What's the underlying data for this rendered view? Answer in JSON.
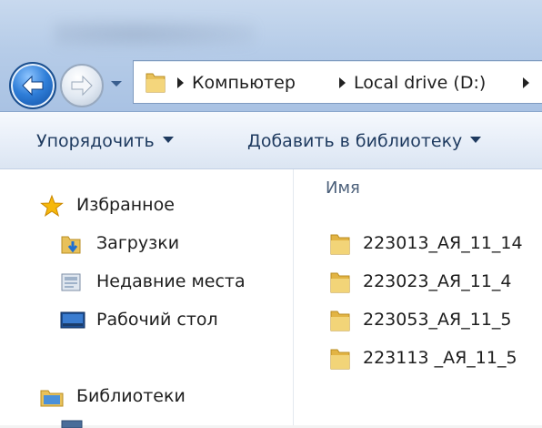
{
  "address_bar": {
    "crumbs": [
      "Компьютер",
      "Local drive (D:)"
    ]
  },
  "toolbar": {
    "organize_label": "Упорядочить",
    "add_to_library_label": "Добавить в библиотеку"
  },
  "navigation": {
    "favorites": {
      "label": "Избранное",
      "icon": "star-icon",
      "items": [
        {
          "label": "Загрузки",
          "icon": "downloads-folder-icon"
        },
        {
          "label": "Недавние места",
          "icon": "recent-places-icon"
        },
        {
          "label": "Рабочий стол",
          "icon": "desktop-icon"
        }
      ]
    },
    "libraries": {
      "label": "Библиотеки",
      "icon": "libraries-icon"
    }
  },
  "content": {
    "column_header": "Имя",
    "files": [
      {
        "name": "223013_АЯ_11_14",
        "icon": "folder-icon"
      },
      {
        "name": "223023_АЯ_11_4",
        "icon": "folder-icon"
      },
      {
        "name": "223053_АЯ_11_5",
        "icon": "folder-icon"
      },
      {
        "name": "223113 _АЯ_11_5",
        "icon": "folder-icon"
      }
    ]
  },
  "colors": {
    "accent": "#2f7ed8",
    "toolbar_text": "#1e3a5f",
    "folder": "#e8c15a",
    "star": "#f2a900"
  }
}
